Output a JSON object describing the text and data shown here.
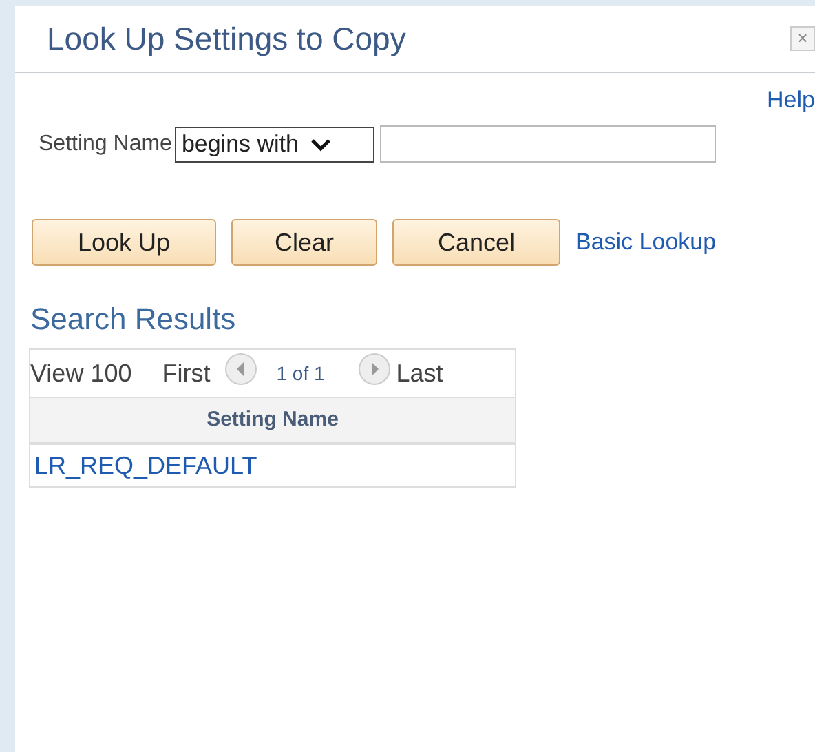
{
  "dialog": {
    "title": "Look Up Settings to Copy",
    "close": "×",
    "help": "Help"
  },
  "criteria": {
    "label": "Setting Name",
    "operator": "begins with"
  },
  "buttons": [
    "Look Up",
    "Clear",
    "Cancel"
  ],
  "link": "Basic Lookup",
  "results": {
    "title": "Search Results",
    "view": "View 100",
    "first": "First",
    "page": "1 of 1",
    "last": "Last",
    "column": "Setting Name",
    "rows": [
      "LR_REQ_DEFAULT"
    ]
  }
}
